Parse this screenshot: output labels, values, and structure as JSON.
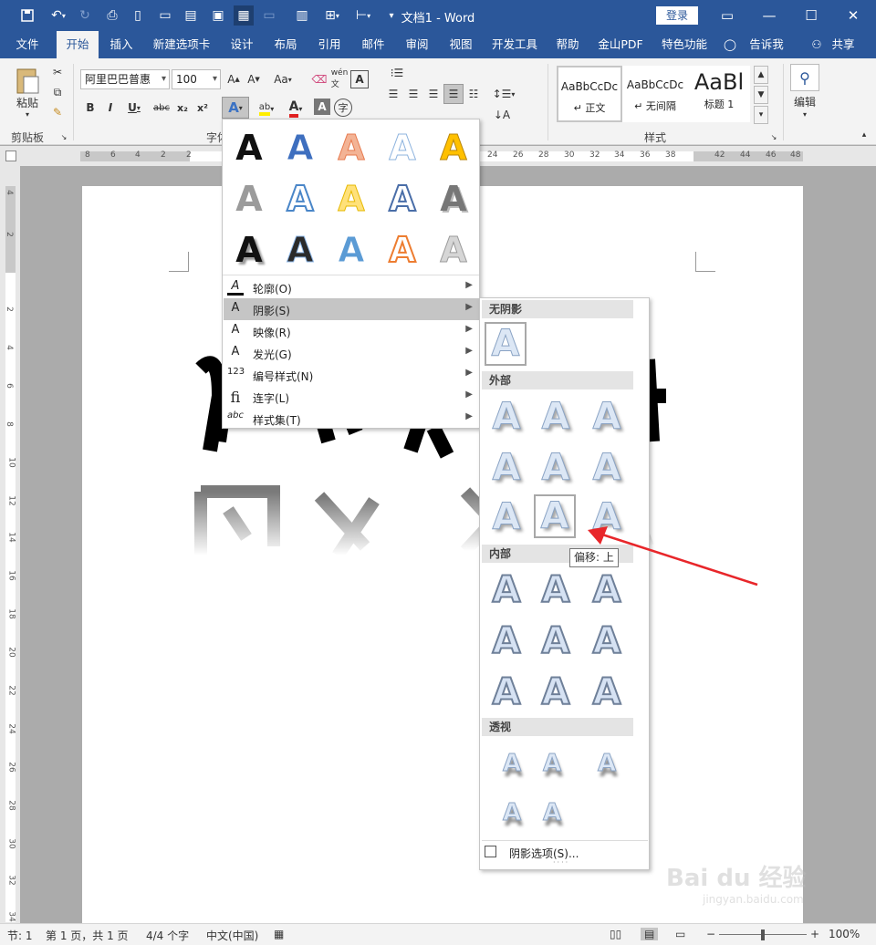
{
  "titlebar": {
    "doc_title": "文档1  -  Word",
    "login": "登录"
  },
  "tabs": [
    "文件",
    "开始",
    "插入",
    "新建选项卡",
    "设计",
    "布局",
    "引用",
    "邮件",
    "审阅",
    "视图",
    "开发工具",
    "帮助",
    "金山PDF",
    "特色功能"
  ],
  "tell_me": "告诉我",
  "share": "共享",
  "ribbon": {
    "paste": "粘贴",
    "clipboard_group": "剪贴板",
    "font_name": "阿里巴巴普惠",
    "font_size": "100",
    "font_group": "字体",
    "styles_group": "样式",
    "styles": [
      {
        "preview": "AaBbCcDc",
        "name": "↵ 正文"
      },
      {
        "preview": "AaBbCcDc",
        "name": "↵ 无间隔"
      },
      {
        "preview": "AaBl",
        "name": "标题 1"
      }
    ],
    "edit": "编辑"
  },
  "ruler": {
    "h_ticks": [
      "8",
      "6",
      "4",
      "2",
      "2",
      "24",
      "26",
      "28",
      "30",
      "32",
      "34",
      "36",
      "38",
      "42",
      "44",
      "46",
      "48"
    ],
    "v_ticks": [
      "4",
      "2",
      "2",
      "4",
      "6",
      "8",
      "10",
      "12",
      "14",
      "16",
      "18",
      "20",
      "22",
      "24",
      "26",
      "28",
      "30",
      "32",
      "34"
    ]
  },
  "document": {
    "text_fragment": "↵"
  },
  "effects_menu": {
    "items": [
      {
        "label": "轮廓(O)",
        "icon": "A"
      },
      {
        "label": "阴影(S)",
        "icon": "A"
      },
      {
        "label": "映像(R)",
        "icon": "A"
      },
      {
        "label": "发光(G)",
        "icon": "A"
      },
      {
        "label": "编号样式(N)",
        "icon": "123"
      },
      {
        "label": "连字(L)",
        "icon": "fi"
      },
      {
        "label": "样式集(T)",
        "icon": "abc"
      }
    ]
  },
  "shadow_menu": {
    "sections": [
      "无阴影",
      "外部",
      "内部",
      "透视"
    ],
    "tooltip": "偏移: 上",
    "options": "阴影选项(S)..."
  },
  "statusbar": {
    "section": "节: 1",
    "page": "第 1 页，共 1 页",
    "words": "4/4 个字",
    "lang": "中文(中国)",
    "zoom": "100%"
  },
  "watermark": {
    "brand": "Bai  du 经验",
    "url": "jingyan.baidu.com"
  },
  "colors": {
    "brand": "#2b579a",
    "arrow": "#e8262a"
  }
}
